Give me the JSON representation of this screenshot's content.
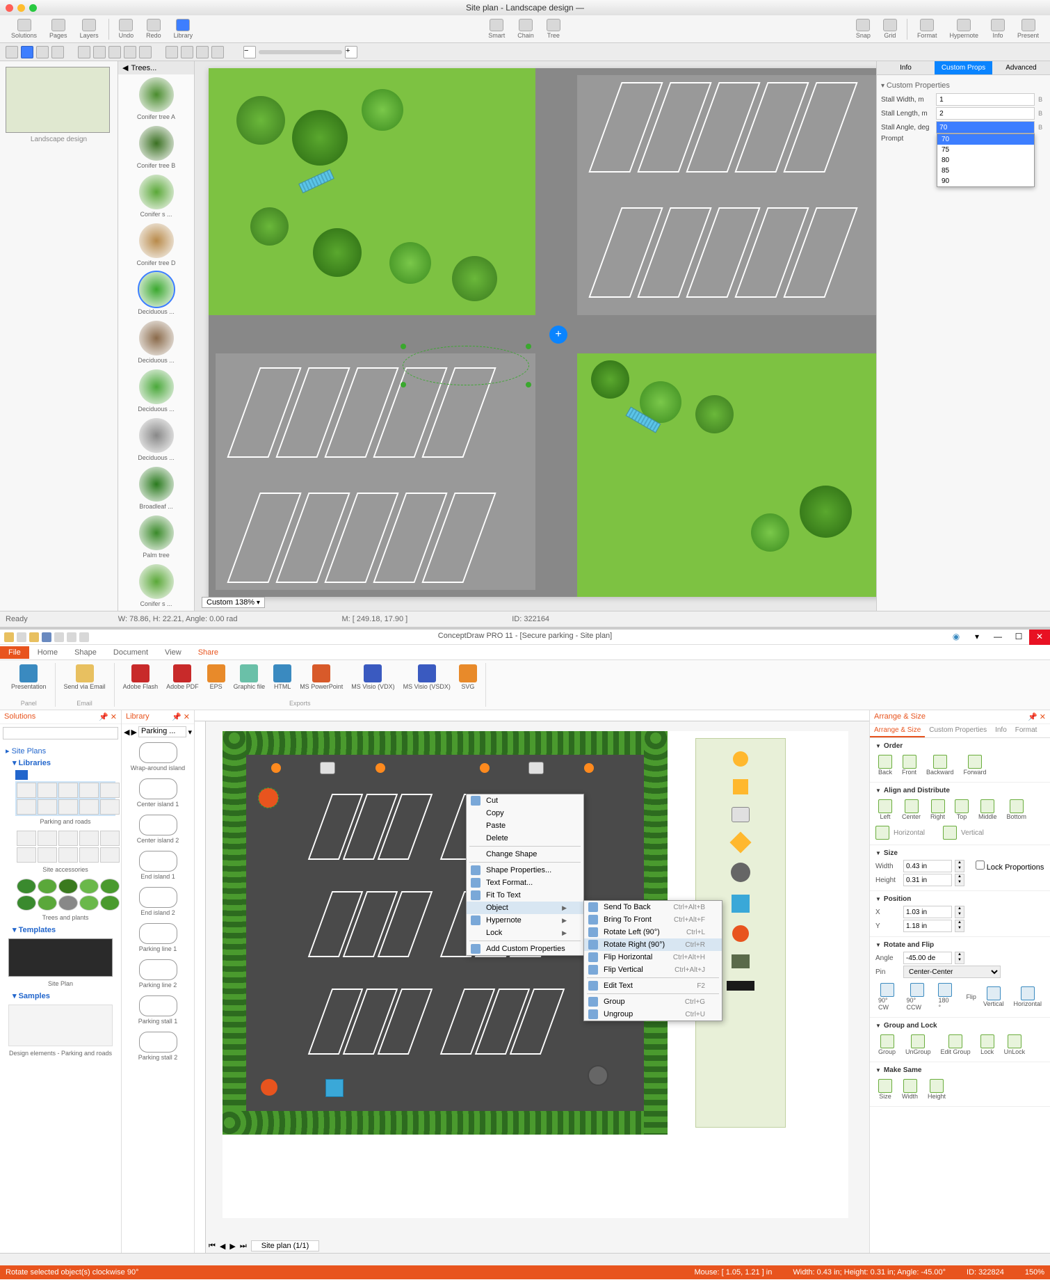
{
  "mac": {
    "title": "Site plan - Landscape design —",
    "toolbar": {
      "solutions": "Solutions",
      "pages": "Pages",
      "layers": "Layers",
      "undo": "Undo",
      "redo": "Redo",
      "library": "Library",
      "smart": "Smart",
      "chain": "Chain",
      "tree": "Tree",
      "snap": "Snap",
      "grid": "Grid",
      "format": "Format",
      "hypernote": "Hypernote",
      "info": "Info",
      "present": "Present"
    },
    "thumb_label": "Landscape design",
    "lib_header": "Trees...",
    "lib_items": [
      {
        "name": "Conifer tree  A",
        "color": "#4a8c2e"
      },
      {
        "name": "Conifer tree  B",
        "color": "#3a7022"
      },
      {
        "name": "Conifer s ...",
        "color": "#5aa838"
      },
      {
        "name": "Conifer tree D",
        "color": "#b88a4a"
      },
      {
        "name": "Deciduous ...",
        "color": "#3aa82e",
        "selected": true
      },
      {
        "name": "Deciduous ...",
        "color": "#8a6a4a"
      },
      {
        "name": "Deciduous ...",
        "color": "#4aa83a"
      },
      {
        "name": "Deciduous ...",
        "color": "#888"
      },
      {
        "name": "Broadleaf ...",
        "color": "#2a7a1e"
      },
      {
        "name": "Palm tree",
        "color": "#3a8a2a"
      },
      {
        "name": "Conifer s ...",
        "color": "#5aa838"
      }
    ],
    "zoom": "Custom 138%",
    "status": {
      "ready": "Ready",
      "wh": "W: 78.86,  H: 22.21,  Angle: 0.00 rad",
      "mouse": "M: [ 249.18, 17.90 ]",
      "id": "ID: 322164"
    },
    "props": {
      "tab_info": "Info",
      "tab_custom": "Custom Props",
      "tab_adv": "Advanced",
      "section": "Custom Properties",
      "fields": {
        "width_lbl": "Stall Width, m",
        "width_val": "1",
        "length_lbl": "Stall Length, m",
        "length_val": "2",
        "angle_lbl": "Stall Angle, deg",
        "angle_val": "70",
        "prompt_lbl": "Prompt"
      },
      "unit": "B",
      "dropdown": [
        "70",
        "75",
        "80",
        "85",
        "90"
      ]
    }
  },
  "win": {
    "title": "ConceptDraw PRO 11 - [Secure parking - Site plan]",
    "menu": {
      "file": "File",
      "home": "Home",
      "shape": "Shape",
      "document": "Document",
      "view": "View",
      "share": "Share"
    },
    "ribbon": {
      "presentation": "Presentation",
      "send_email": "Send via Email",
      "adobe_flash": "Adobe Flash",
      "adobe_pdf": "Adobe PDF",
      "eps": "EPS",
      "graphic": "Graphic file",
      "html": "HTML",
      "ppt": "MS PowerPoint",
      "visio_vdx": "MS Visio (VDX)",
      "visio_vsdx": "MS Visio (VSDX)",
      "svg": "SVG",
      "grp_panel": "Panel",
      "grp_email": "Email",
      "grp_exports": "Exports"
    },
    "panels": {
      "solutions": "Solutions",
      "library": "Library",
      "arrange": "Arrange & Size"
    },
    "sol": {
      "site_plans": "Site Plans",
      "libraries": "Libraries",
      "parking_roads": "Parking and roads",
      "site_acc": "Site accessories",
      "trees_plants": "Trees and plants",
      "templates": "Templates",
      "site_plan": "Site Plan",
      "samples": "Samples",
      "design_elements": "Design elements - Parking and roads"
    },
    "lib_combo": "Parking ...",
    "lib_items": [
      {
        "name": "Wrap-around island"
      },
      {
        "name": "Center island 1"
      },
      {
        "name": "Center island 2"
      },
      {
        "name": "End island 1"
      },
      {
        "name": "End island 2"
      },
      {
        "name": "Parking line 1"
      },
      {
        "name": "Parking line 2"
      },
      {
        "name": "Parking stall 1"
      },
      {
        "name": "Parking stall 2"
      }
    ],
    "ctx": {
      "cut": "Cut",
      "copy": "Copy",
      "paste": "Paste",
      "delete": "Delete",
      "change_shape": "Change Shape",
      "shape_props": "Shape Properties...",
      "text_format": "Text Format...",
      "fit_text": "Fit To Text",
      "object": "Object",
      "hypernote": "Hypernote",
      "lock": "Lock",
      "add_custom": "Add Custom Properties",
      "sub": {
        "send_back": "Send To Back",
        "sc_back": "Ctrl+Alt+B",
        "bring_front": "Bring To Front",
        "sc_front": "Ctrl+Alt+F",
        "rot_left": "Rotate Left (90°)",
        "sc_left": "Ctrl+L",
        "rot_right": "Rotate Right (90°)",
        "sc_right": "Ctrl+R",
        "flip_h": "Flip Horizontal",
        "sc_fh": "Ctrl+Alt+H",
        "flip_v": "Flip Vertical",
        "sc_fv": "Ctrl+Alt+J",
        "edit_text": "Edit Text",
        "sc_et": "F2",
        "group": "Group",
        "sc_g": "Ctrl+G",
        "ungroup": "Ungroup",
        "sc_ug": "Ctrl+U"
      }
    },
    "arr": {
      "tab_as": "Arrange & Size",
      "tab_cp": "Custom Properties",
      "tab_info": "Info",
      "tab_fmt": "Format",
      "order": "Order",
      "back": "Back",
      "front": "Front",
      "backward": "Backward",
      "forward": "Forward",
      "align": "Align and Distribute",
      "left": "Left",
      "center": "Center",
      "right": "Right",
      "top": "Top",
      "middle": "Middle",
      "bottom": "Bottom",
      "horizontal": "Horizontal",
      "vertical": "Vertical",
      "size": "Size",
      "width_l": "Width",
      "width_v": "0.43 in",
      "height_l": "Height",
      "height_v": "0.31 in",
      "lock_prop": "Lock Proportions",
      "position": "Position",
      "x_l": "X",
      "x_v": "1.03 in",
      "y_l": "Y",
      "y_v": "1.18 in",
      "rotflip": "Rotate and Flip",
      "angle_l": "Angle",
      "angle_v": "-45.00 de",
      "pin_l": "Pin",
      "pin_v": "Center-Center",
      "cw": "90° CW",
      "ccw": "90° CCW",
      "r180": "180 °",
      "flip": "Flip",
      "vert": "Vertical",
      "horiz": "Horizontal",
      "grplock": "Group and Lock",
      "grp": "Group",
      "ungrp": "UnGroup",
      "editgrp": "Edit Group",
      "lock": "Lock",
      "unlock": "UnLock",
      "makesame": "Make Same",
      "ms_size": "Size",
      "ms_w": "Width",
      "ms_h": "Height"
    },
    "page_tab": "Site plan (1/1)",
    "status": {
      "hint": "Rotate selected object(s) clockwise 90°",
      "mouse": "Mouse: [ 1.05, 1.21 ] in",
      "wh": "Width: 0.43 in;  Height: 0.31 in;  Angle: -45.00°",
      "id": "ID: 322824",
      "zoom": "150%"
    }
  }
}
